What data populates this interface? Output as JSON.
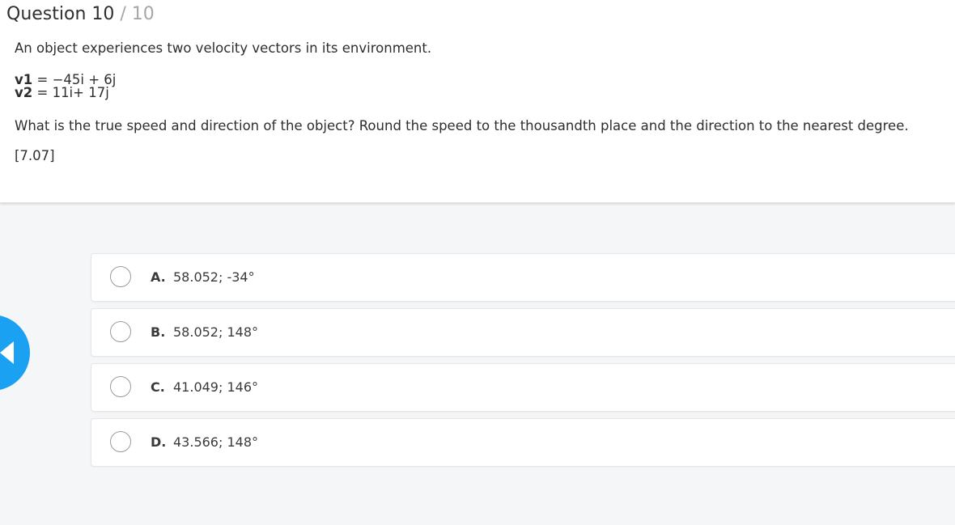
{
  "header": {
    "question_label": "Question 10",
    "total": " / 10"
  },
  "question": {
    "intro": "An object experiences two velocity vectors in its environment.",
    "v1_label": "v1",
    "v1_value": " = −45i + 6j",
    "v2_label": "v2",
    "v2_value": " = 11i+ 17j",
    "prompt": "What is the true speed and direction of the object? Round the speed to the thousandth place and the direction to the nearest degree.",
    "hint": "[7.07]"
  },
  "options": [
    {
      "letter": "A.",
      "text": "58.052; -34°"
    },
    {
      "letter": "B.",
      "text": "58.052; 148°"
    },
    {
      "letter": "C.",
      "text": "41.049; 146°"
    },
    {
      "letter": "D.",
      "text": "43.566; 148°"
    }
  ],
  "colors": {
    "accent": "#1ba1f2",
    "background": "#f5f6f8"
  },
  "icons": {
    "back": "chevron-left-icon",
    "radio": "radio-button-icon"
  }
}
